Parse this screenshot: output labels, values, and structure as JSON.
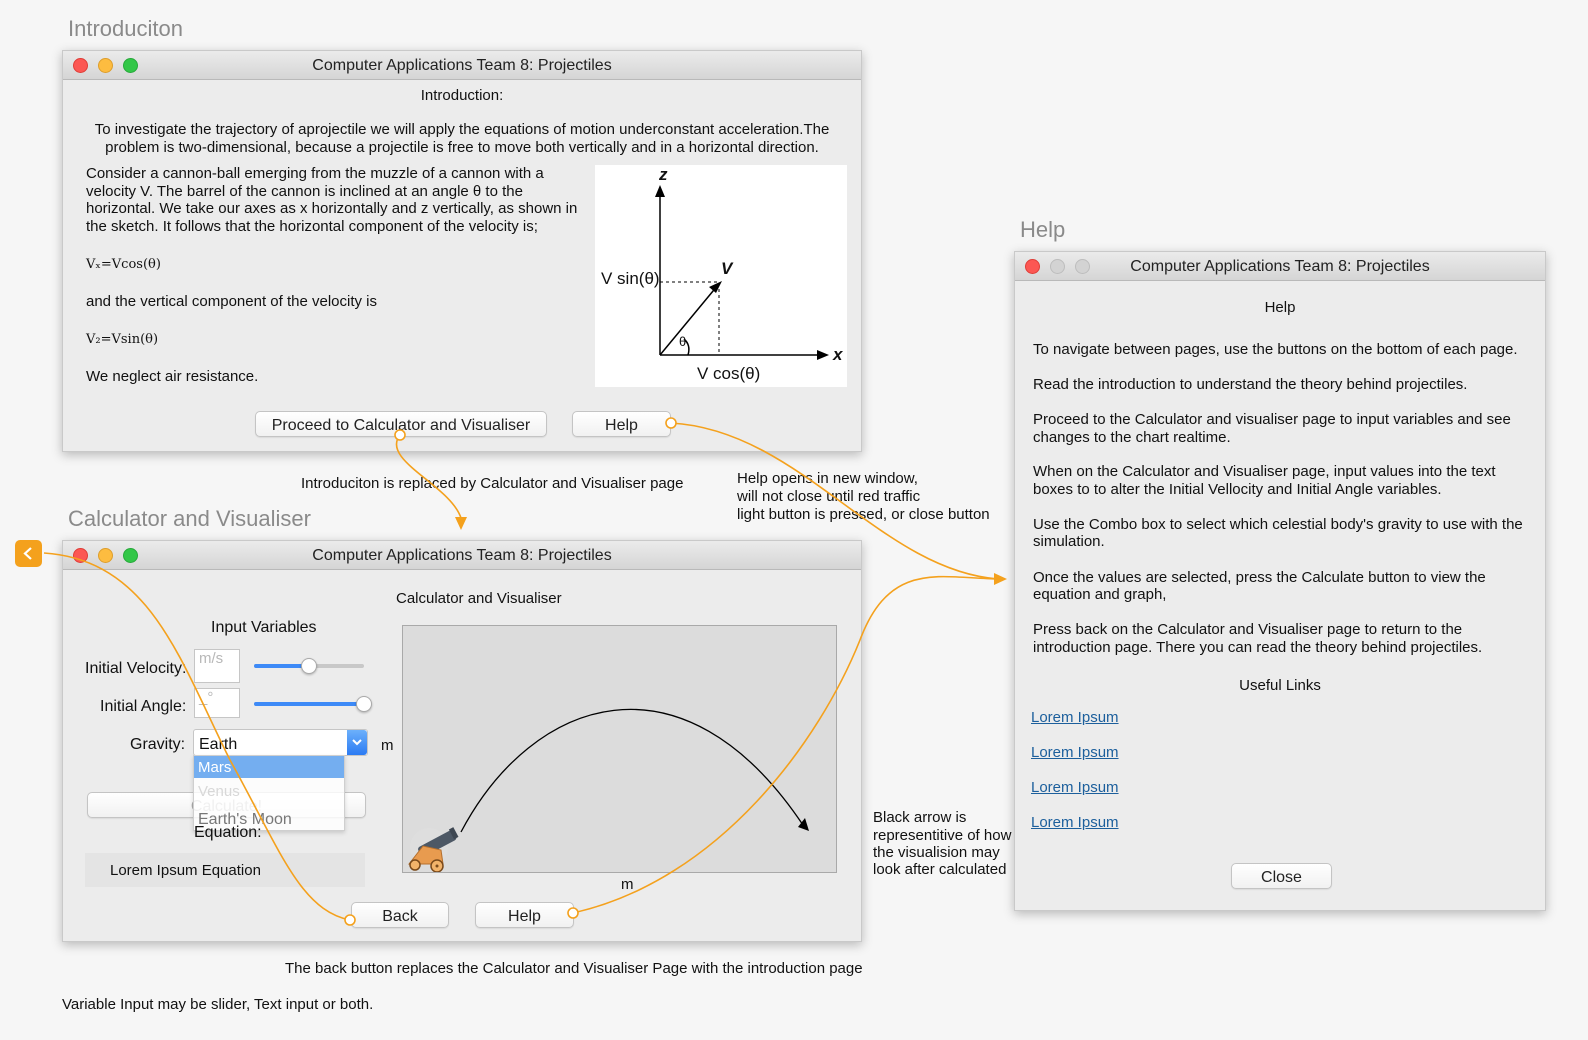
{
  "sections": {
    "intro_title": "Introduciton",
    "calc_title": "Calculator and Visualiser",
    "help_title": "Help"
  },
  "window_title": "Computer Applications Team 8: Projectiles",
  "intro": {
    "heading": "Introduction:",
    "para1_line1": "To investigate the trajectory of aprojectile we will apply the equations of motion underconstant acceleration.The",
    "para1_line2": "problem is two-dimensional, because a projectile is free to move both vertically and in a horizontal direction.",
    "para2_lines": [
      "Consider a cannon-ball emerging from the muzzle of a cannon with a",
      "velocity V. The barrel of the cannon is inclined at an angle θ to the",
      "horizontal. We take our axes as x horizontally and z vertically, as shown in",
      "the sketch. It follows that the horizontal component of the velocity is;"
    ],
    "eq_vx": "Vₓ=Vcos(θ)",
    "vertical_text": "and the vertical component of the velocity is",
    "eq_vz": "V₂=Vsin(θ)",
    "air_text": "We neglect air resistance.",
    "diagram": {
      "z": "z",
      "x": "x",
      "v": "V",
      "vsin": "V sin(θ)",
      "vcos": "V cos(θ)",
      "theta": "θ"
    },
    "proceed_button": "Proceed to Calculator and Visualiser",
    "help_button": "Help"
  },
  "calc": {
    "heading": "Calculator and Visualiser",
    "input_heading": "Input Variables",
    "velocity_label": "Initial Velocity:",
    "velocity_placeholder": "m/s",
    "velocity_level": 0.5,
    "angle_label": "Initial Angle:",
    "angle_placeholder": "_°",
    "angle_level": 1.0,
    "gravity_label": "Gravity:",
    "gravity_value": "Earth",
    "gravity_options": [
      "Mars",
      "Venus",
      "Earth's Moon"
    ],
    "unit_m_side": "m",
    "unit_m_bottom": "m",
    "calculate_button": "Calculate!",
    "equation_label": "Equation:",
    "equation_value": "Lorem Ipsum Equation",
    "back_button": "Back",
    "help_button": "Help"
  },
  "help": {
    "heading": "Help",
    "paragraphs": [
      [
        "To navigate between pages, use the buttons on the bottom of each page."
      ],
      [
        "Read the introduction to understand the theory behind projectiles."
      ],
      [
        "Proceed to the Calculator and visualiser page to input variables and see",
        "changes to the chart realtime."
      ],
      [
        "When on the Calculator and Visualiser page, input values into the text",
        "boxes to to alter the Initial Vellocity and Initial Angle variables."
      ],
      [
        "Use the Combo box to select which celestial body's gravity to use with the",
        "simulation."
      ],
      [
        "Once the values are selected, press the Calculate button to view the",
        "equation and graph,"
      ],
      [
        "Press back on the Calculator and Visualiser page to return to the",
        "introduction page. There you can read the theory behind projectiles."
      ]
    ],
    "useful_links_heading": "Useful Links",
    "links": [
      "Lorem Ipsum",
      "Lorem Ipsum",
      "Lorem Ipsum",
      "Lorem Ipsum"
    ],
    "close_button": "Close"
  },
  "annotations": {
    "replace_note": "Introduciton is replaced by Calculator and Visualiser page",
    "help_note": [
      "Help opens in new window,",
      "will not close until red traffic",
      "light button is pressed, or close button"
    ],
    "arrow_note": [
      "Black arrow is",
      "representitive of how",
      "the visualision may",
      "look after calculated"
    ],
    "back_note": "The back button replaces the Calculator and Visualiser Page with the introduction page",
    "variable_note": "Variable Input may be slider, Text input or both."
  },
  "colors": {
    "flow_arrow": "#f4a11d",
    "slider_fill": "#3d8af7",
    "link": "#1c5f9c",
    "dropdown_highlight": "#74aef0"
  }
}
